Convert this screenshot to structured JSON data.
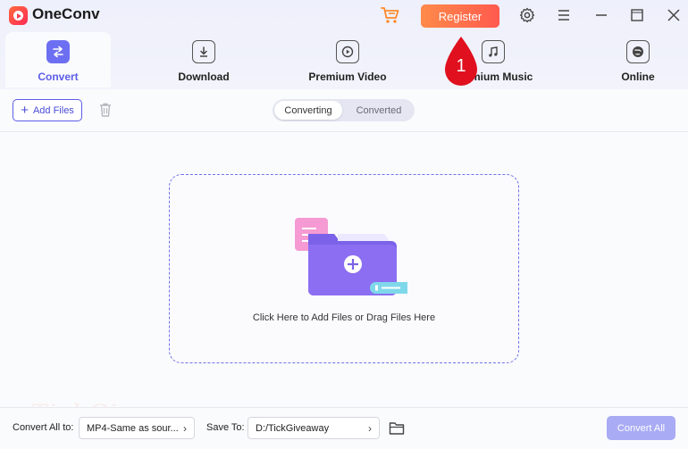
{
  "app": {
    "title": "OneConv"
  },
  "header": {
    "register_label": "Register"
  },
  "tabs": [
    {
      "label": "Convert",
      "icon": "convert-icon",
      "active": true
    },
    {
      "label": "Download",
      "icon": "download-icon",
      "active": false
    },
    {
      "label": "Premium Video",
      "icon": "play-icon",
      "active": false
    },
    {
      "label": "Premium Music",
      "icon": "music-icon",
      "active": false
    },
    {
      "label": "Online",
      "icon": "globe-icon",
      "active": false
    }
  ],
  "toolbar": {
    "add_files_label": "Add Files",
    "segments": {
      "converting": "Converting",
      "converted": "Converted",
      "selected": "Converting"
    }
  },
  "dropzone": {
    "text": "Click Here to Add Files or Drag Files Here"
  },
  "annotation": {
    "marker": "1",
    "color": "#e0101e"
  },
  "watermark": {
    "text": "TickGiveaway"
  },
  "footer": {
    "convert_all_to_label": "Convert All to:",
    "format_value": "MP4-Same as sour...",
    "save_to_label": "Save To:",
    "save_path": "D:/TickGiveaway",
    "convert_all_label": "Convert All"
  },
  "colors": {
    "accent": "#5b5de8",
    "register": "#ff6a4e",
    "convert_all": "#a9abf4"
  }
}
